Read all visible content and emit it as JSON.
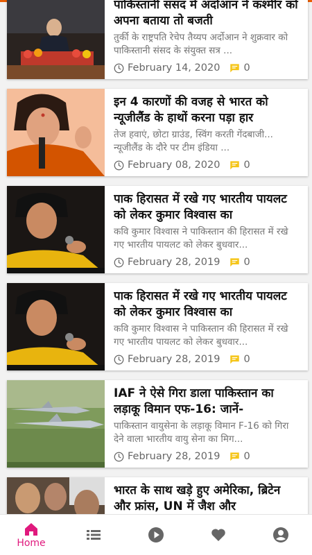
{
  "articles": [
    {
      "title": "पाकिस्तानी संसद में अर्दोआन ने कश्मीर को अपना बताया तो बजती",
      "excerpt": "तुर्की के राष्ट्रपति रेचेप तैय्यप अर्दोआन ने शुक्रवार को पाकिस्तानी संसद के संयुक्त सत्र ...",
      "date": "February 14, 2020",
      "comments": "0"
    },
    {
      "title": "इन 4 कारणों की वजह से भारत को न्यूजीलैंड के हाथों करना पड़ा हार",
      "excerpt": "तेज हवाएं, छोटा ग्राउंड, स्विंग करती गेंदबाजी... न्यूजीलैंड के दौरे पर टीम इंडिया ...",
      "date": "February 08, 2020",
      "comments": "0"
    },
    {
      "title": "पाक हिरासत में रखे गए भारतीय पायलट को लेकर कुमार विश्वास का",
      "excerpt": "कवि कुमार विश्वास ने पाकिस्तान की हिरासत में रखे गए भारतीय पायलट को लेकर बुधवार...",
      "date": "February 28, 2019",
      "comments": "0"
    },
    {
      "title": "पाक हिरासत में रखे गए भारतीय पायलट को लेकर कुमार विश्वास का",
      "excerpt": "कवि कुमार विश्वास ने पाकिस्तान की हिरासत में रखे गए भारतीय पायलट को लेकर बुधवार...",
      "date": "February 28, 2019",
      "comments": "0"
    },
    {
      "title": "IAF ने ऐसे गिरा डाला पाकिस्तान का लड़ाकू विमान एफ-16: जानें-",
      "excerpt": "पाकिस्तान वायुसेना के लड़ाकू विमान F-16 को गिरा देने वाला भारतीय वायु सेना का मिग...",
      "date": "February 28, 2019",
      "comments": "0"
    },
    {
      "title": "भारत के साथ खड़े हुए अमेरिका, ब्रिटेन और फ्रांस, UN में जैश और",
      "excerpt": "",
      "date": "",
      "comments": ""
    }
  ],
  "nav": {
    "home_label": "Home",
    "active_color": "#e0197d",
    "icon_color": "#666666"
  },
  "colors": {
    "comment_icon": "#f5c518",
    "accent_bar": "#e85d04"
  }
}
